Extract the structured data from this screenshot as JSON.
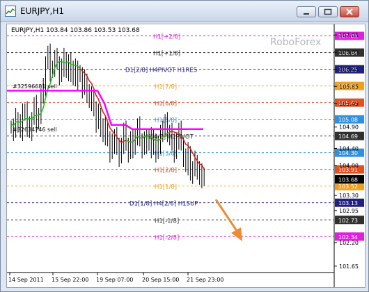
{
  "window": {
    "title": "EURJPY,H1"
  },
  "ohlc": {
    "header": "EURJPY,H1  103.84  103.86  103.53  103.68"
  },
  "watermark": "RoboForex",
  "orders": [
    {
      "label": "#32596681 sell"
    },
    {
      "label": "#32634746 sell"
    }
  ],
  "levels": [
    {
      "label": "H1[+2/8]",
      "color": "#e020e0",
      "price_tag": "107.03",
      "y_data": 107.03
    },
    {
      "label": "H1[+1/8]",
      "color": "#303030",
      "price_tag": "106.64",
      "y_data": 106.64
    },
    {
      "label": "D1[2/8] H4PIVOT H1RES",
      "color": "#202080",
      "price_tag": "106.25",
      "y_data": 106.25
    },
    {
      "label": "H1[7/8]",
      "color": "#f0a020",
      "price_tag": "105.86",
      "y_data": 105.86
    },
    {
      "label": "H1[6/8]",
      "color": "#e05020",
      "price_tag": "105.47",
      "y_data": 105.47
    },
    {
      "label": "H1[5/8]",
      "color": "#3090e0",
      "price_tag": "105.08",
      "y_data": 105.08
    },
    {
      "label": "H1[4/8]  H1PIVOT",
      "color": "#303030",
      "price_tag": "104.69",
      "y_data": 104.69
    },
    {
      "label": "H1[3/8]",
      "color": "#3090e0",
      "price_tag": "104.30",
      "y_data": 104.3
    },
    {
      "label": "H1[2/8]",
      "color": "#e05020",
      "price_tag": "103.91",
      "y_data": 103.91
    },
    {
      "label": "H1[1/8]",
      "color": "#f0a020",
      "price_tag": "103.52",
      "y_data": 103.52
    },
    {
      "label": "D1[1/8] H4[2/8] H1SUP",
      "color": "#202080",
      "price_tag": "103.13",
      "y_data": 103.13
    },
    {
      "label": "H1[-1/8]",
      "color": "#303030",
      "price_tag": "102.73",
      "y_data": 102.73
    },
    {
      "label": "H1[-2/8]",
      "color": "#e020e0",
      "price_tag": "102.34",
      "y_data": 102.34
    }
  ],
  "current_price": {
    "tag": "103.68",
    "value": 103.68
  },
  "axis": {
    "y_ticks": [
      "107.05",
      "106.65",
      "106.25",
      "105.85",
      "105.45",
      "104.90",
      "104.40",
      "104.00",
      "103.30",
      "102.95",
      "102.20",
      "101.65"
    ],
    "x_ticks": [
      "14 Sep 2011",
      "15 Sep 22:00",
      "19 Sep 07:00",
      "20 Sep 15:00",
      "21 Sep 23:00"
    ]
  },
  "chart_data": {
    "type": "candlestick",
    "title": "EURJPY,H1",
    "ylim": [
      101.5,
      107.3
    ],
    "bars_close": [
      104.9,
      104.8,
      105.1,
      105.0,
      104.8,
      105.2,
      105.3,
      104.9,
      104.8,
      105.1,
      105.4,
      105.0,
      105.2,
      105.6,
      105.8,
      106.4,
      106.6,
      106.2,
      106.3,
      106.5,
      106.4,
      106.1,
      106.3,
      106.5,
      106.2,
      106.4,
      106.1,
      106.3,
      106.0,
      106.2,
      106.1,
      105.8,
      106.0,
      105.7,
      105.5,
      105.6,
      105.3,
      105.0,
      105.2,
      104.9,
      104.7,
      104.9,
      104.6,
      104.3,
      104.5,
      104.7,
      104.4,
      104.2,
      104.5,
      104.8,
      104.5,
      104.3,
      104.6,
      104.4,
      104.7,
      104.9,
      104.6,
      104.4,
      104.6,
      104.5,
      104.7,
      104.4,
      104.6,
      104.3,
      104.5,
      104.7,
      104.9,
      105.0,
      104.7,
      104.8,
      104.5,
      104.3,
      104.6,
      104.8,
      104.5,
      104.2,
      104.0,
      104.3,
      103.8,
      103.9,
      104.1,
      103.9,
      103.7,
      103.8,
      103.68
    ]
  }
}
